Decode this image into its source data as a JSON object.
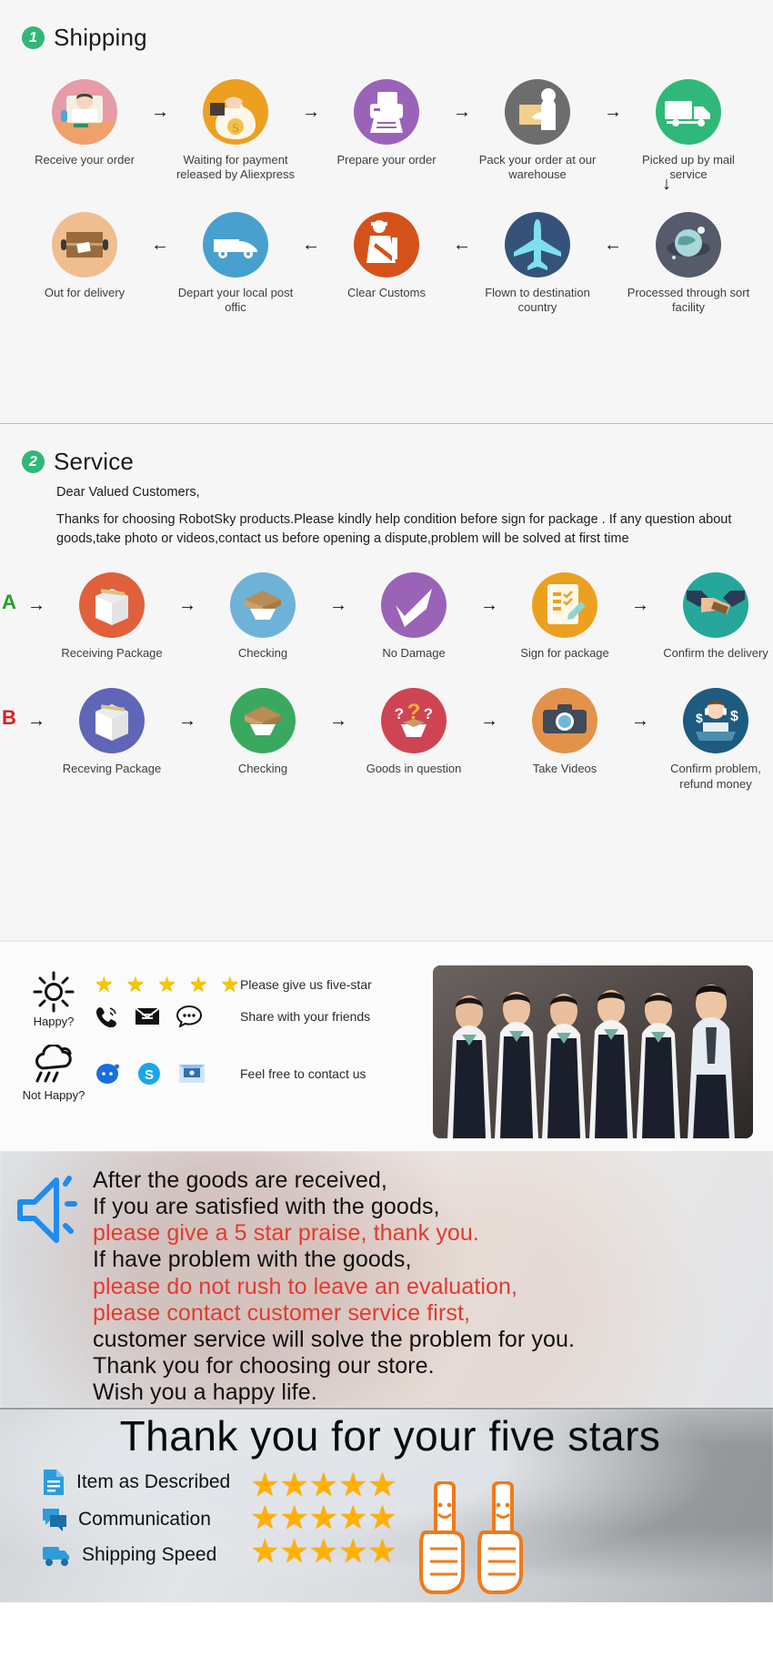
{
  "shipping": {
    "badge": "1",
    "title": "Shipping",
    "row1": [
      {
        "label": "Receive your order",
        "icon": "person-at-desk-icon",
        "color": "#e79aa7"
      },
      {
        "label": "Waiting for payment released by Aliexpress",
        "icon": "money-bag-hand-icon",
        "color": "#eda01f"
      },
      {
        "label": "Prepare your order",
        "icon": "printer-icon",
        "color": "#9a63b8"
      },
      {
        "label": "Pack your order at our warehouse",
        "icon": "worker-packing-icon",
        "color": "#6d6d6d"
      },
      {
        "label": "Picked up by mail service",
        "icon": "delivery-truck-icon",
        "color": "#2fb877"
      }
    ],
    "row2": [
      {
        "label": "Out for delivery",
        "icon": "parcel-box-icon",
        "color": "#f0bd8f"
      },
      {
        "label": "Depart your local post offic",
        "icon": "delivery-van-icon",
        "color": "#47a0cd"
      },
      {
        "label": "Clear  Customs",
        "icon": "customs-officer-icon",
        "color": "#d4521a"
      },
      {
        "label": "Flown to destination country",
        "icon": "airplane-icon",
        "color": "#35537a"
      },
      {
        "label": "Processed through sort facility",
        "icon": "globe-night-icon",
        "color": "#555b6b"
      }
    ],
    "arrow_right": "→",
    "arrow_left": "←",
    "arrow_down": "↓"
  },
  "service": {
    "badge": "2",
    "title": "Service",
    "greeting": "Dear Valued Customers,",
    "paragraph": "Thanks for choosing RobotSky products.Please kindly help condition before sign for package . If any question about goods,take photo or videos,contact us before opening a dispute,problem will be solved at first time",
    "row_a_letter": "A",
    "row_b_letter": "B",
    "row_a": [
      {
        "label": "Receiving Package",
        "icon": "white-box-icon",
        "color": "#e0603c"
      },
      {
        "label": "Checking",
        "icon": "open-carton-icon",
        "color": "#6fb2d8"
      },
      {
        "label": "No Damage",
        "icon": "check-mark-icon",
        "color": "#9a63b8"
      },
      {
        "label": "Sign for package",
        "icon": "signed-document-icon",
        "color": "#eda01f"
      },
      {
        "label": "Confirm the delivery",
        "icon": "handshake-icon",
        "color": "#25a79b"
      }
    ],
    "row_b": [
      {
        "label": "Receving Package",
        "icon": "white-box-icon",
        "color": "#5f66b8"
      },
      {
        "label": "Checking",
        "icon": "open-carton-icon",
        "color": "#3aa95f"
      },
      {
        "label": "Goods in question",
        "icon": "question-box-icon",
        "color": "#cf4452"
      },
      {
        "label": "Take Videos",
        "icon": "camera-icon",
        "color": "#e3924a"
      },
      {
        "label": "Confirm problem, refund money",
        "icon": "support-agent-icon",
        "color": "#1d5b80"
      }
    ]
  },
  "feedback": {
    "happy_label": "Happy?",
    "not_happy_label": "Not Happy?",
    "happy_icon": "sun-icon",
    "not_happy_icon": "rain-cloud-icon",
    "star_glyph": "★",
    "star_count": 5,
    "line_five_star": "Please give us five-star",
    "line_share": "Share with your friends",
    "line_contact": "Feel free to contact us",
    "share_icons": [
      "phone-icon",
      "envelope-icon",
      "chat-bubble-icon"
    ],
    "contact_icons": [
      "messenger-icon",
      "skype-icon",
      "email-icon"
    ],
    "photo_name": "customer-service-team-photo"
  },
  "banner": {
    "megaphone_icon": "megaphone-icon",
    "lines": [
      {
        "text": "After the goods are received,",
        "color": "black"
      },
      {
        "text": "If you are satisfied with the goods,",
        "color": "black"
      },
      {
        "text": "please give a 5 star praise, thank you.",
        "color": "red"
      },
      {
        "text": "If have problem with the goods,",
        "color": "black"
      },
      {
        "text": "please do not rush to leave an evaluation,",
        "color": "red"
      },
      {
        "text": "please contact customer service first,",
        "color": "red"
      },
      {
        "text": "customer service will solve the problem for you.",
        "color": "black"
      },
      {
        "text": "Thank you for choosing our store.",
        "color": "black"
      },
      {
        "text": "Wish you a happy life.",
        "color": "black"
      }
    ],
    "red_hex": "#e23b2e"
  },
  "thanks": {
    "title": "Thank you for your five stars",
    "criteria": [
      {
        "label": "Item as Described",
        "icon": "document-icon"
      },
      {
        "label": "Communication",
        "icon": "chat-icon"
      },
      {
        "label": "Shipping  Speed",
        "icon": "truck-icon"
      }
    ],
    "star_glyph": "★",
    "star_rows": 3,
    "stars_per_row": 5,
    "star_color": "#ffb000",
    "thumbs_icon": "thumbs-up-icon",
    "thumbs_count": 2
  }
}
